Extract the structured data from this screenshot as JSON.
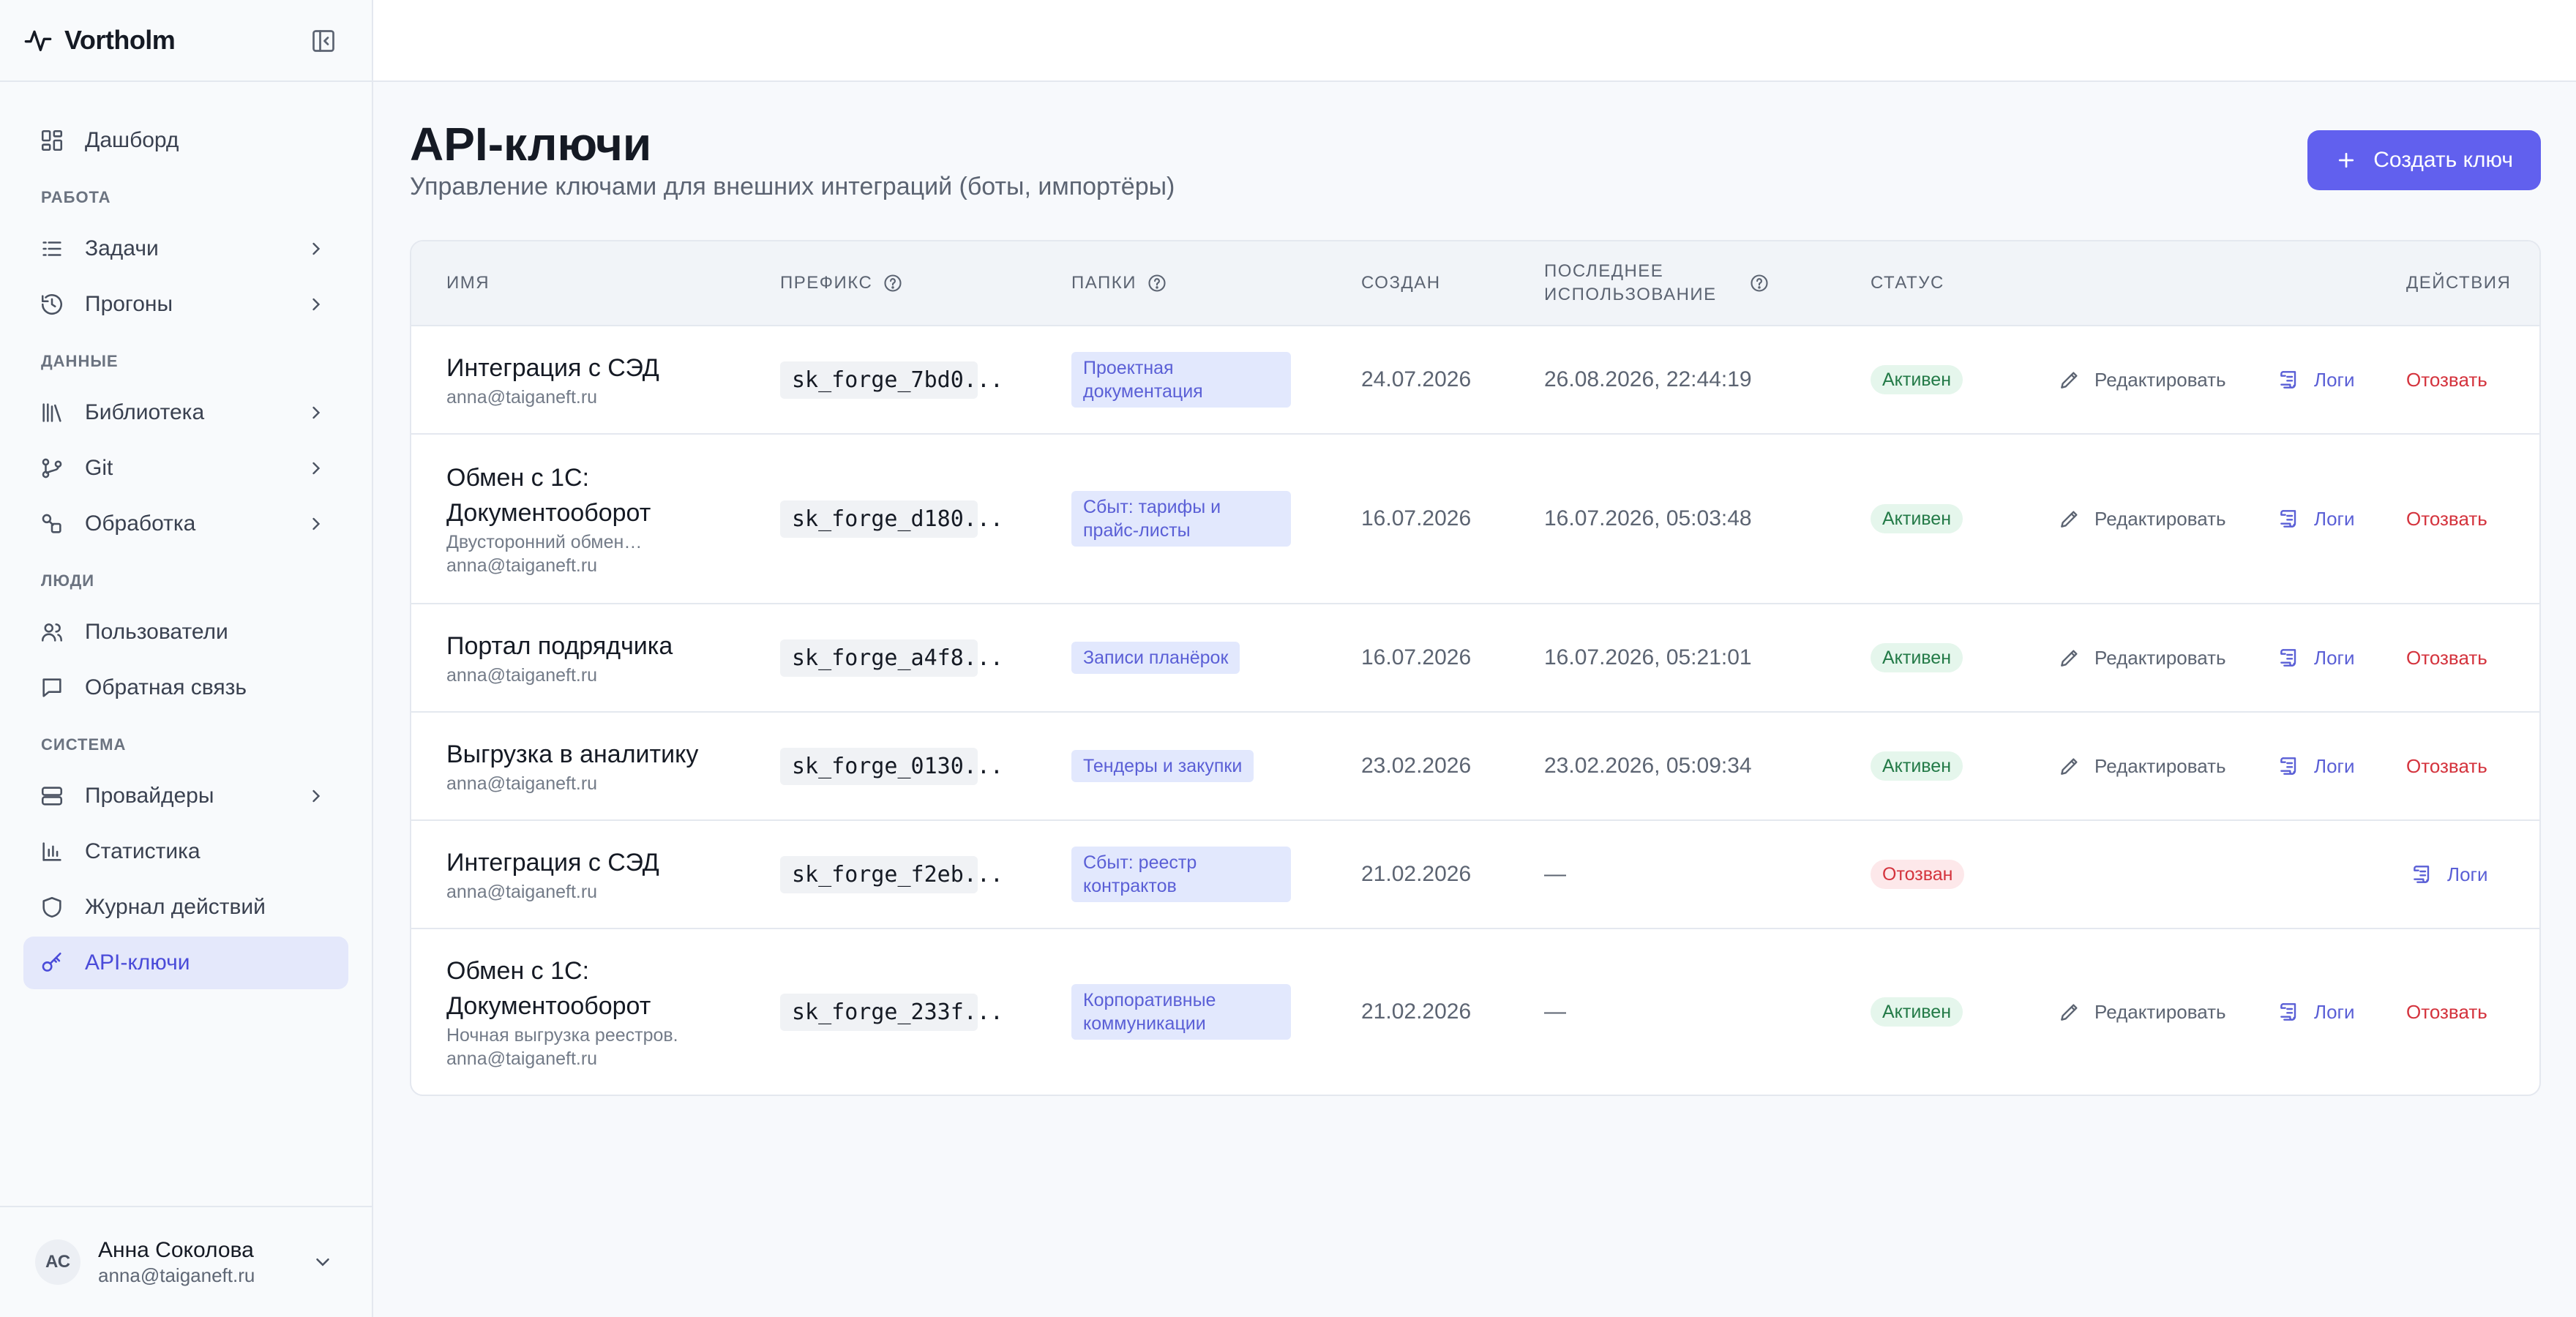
{
  "app": {
    "brand": "Vortholm"
  },
  "sidebar": {
    "top_item": {
      "label": "Дашборд",
      "icon": "dashboard-icon"
    },
    "sections": [
      {
        "title": "РАБОТА",
        "items": [
          {
            "label": "Задачи",
            "icon": "tasks-icon",
            "chevron": true
          },
          {
            "label": "Прогоны",
            "icon": "history-icon",
            "chevron": true
          }
        ]
      },
      {
        "title": "ДАННЫЕ",
        "items": [
          {
            "label": "Библиотека",
            "icon": "library-icon",
            "chevron": true
          },
          {
            "label": "Git",
            "icon": "git-icon",
            "chevron": true
          },
          {
            "label": "Обработка",
            "icon": "processing-icon",
            "chevron": true
          }
        ]
      },
      {
        "title": "ЛЮДИ",
        "items": [
          {
            "label": "Пользователи",
            "icon": "users-icon",
            "chevron": false
          },
          {
            "label": "Обратная связь",
            "icon": "feedback-icon",
            "chevron": false
          }
        ]
      },
      {
        "title": "СИСТЕМА",
        "items": [
          {
            "label": "Провайдеры",
            "icon": "providers-icon",
            "chevron": true
          },
          {
            "label": "Статистика",
            "icon": "stats-icon",
            "chevron": false
          },
          {
            "label": "Журнал действий",
            "icon": "shield-icon",
            "chevron": false
          },
          {
            "label": "API-ключи",
            "icon": "key-icon",
            "chevron": false,
            "active": true
          }
        ]
      }
    ],
    "user": {
      "initials": "АС",
      "name": "Анна Соколова",
      "email": "anna@taiganeft.ru"
    }
  },
  "page": {
    "title": "API-ключи",
    "subtitle": "Управление ключами для внешних интеграций (боты, импортёры)",
    "create_button": "Создать ключ"
  },
  "table": {
    "headers": {
      "name": "ИМЯ",
      "prefix": "ПРЕФИКС",
      "folders": "ПАПКИ",
      "created": "СОЗДАН",
      "last_used_1": "ПОСЛЕДНЕЕ",
      "last_used_2": "ИСПОЛЬЗОВАНИЕ",
      "status": "СТАТУС",
      "actions": "ДЕЙСТВИЯ"
    },
    "action_labels": {
      "edit": "Редактировать",
      "logs": "Логи",
      "revoke": "Отозвать"
    },
    "rows": [
      {
        "name": "Интеграция с СЭД",
        "desc": "",
        "email": "anna@taiganeft.ru",
        "prefix": "sk_forge_7bd0...",
        "folder": "Проектная документация",
        "created": "24.07.2026",
        "last_used": "26.08.2026, 22:44:19",
        "status": "Активен"
      },
      {
        "name": "Обмен с 1С: Документооборот",
        "desc": "Двусторонний обмен…",
        "email": "anna@taiganeft.ru",
        "prefix": "sk_forge_d180...",
        "folder": "Сбыт: тарифы и прайс-листы",
        "created": "16.07.2026",
        "last_used": "16.07.2026, 05:03:48",
        "status": "Активен"
      },
      {
        "name": "Портал подрядчика",
        "desc": "",
        "email": "anna@taiganeft.ru",
        "prefix": "sk_forge_a4f8...",
        "folder": "Записи планёрок",
        "created": "16.07.2026",
        "last_used": "16.07.2026, 05:21:01",
        "status": "Активен"
      },
      {
        "name": "Выгрузка в аналитику",
        "desc": "",
        "email": "anna@taiganeft.ru",
        "prefix": "sk_forge_0130...",
        "folder": "Тендеры и закупки",
        "created": "23.02.2026",
        "last_used": "23.02.2026, 05:09:34",
        "status": "Активен"
      },
      {
        "name": "Интеграция с СЭД",
        "desc": "",
        "email": "anna@taiganeft.ru",
        "prefix": "sk_forge_f2eb...",
        "folder": "Сбыт: реестр контрактов",
        "created": "21.02.2026",
        "last_used": "—",
        "status": "Отозван"
      },
      {
        "name": "Обмен с 1С: Документооборот",
        "desc": "Ночная выгрузка реестров.",
        "email": "anna@taiganeft.ru",
        "prefix": "sk_forge_233f...",
        "folder": "Корпоративные коммуникации",
        "created": "21.02.2026",
        "last_used": "—",
        "status": "Активен"
      }
    ]
  },
  "colors": {
    "accent": "#6160ee",
    "active_text": "#237a47",
    "revoked_text": "#d4333d"
  }
}
